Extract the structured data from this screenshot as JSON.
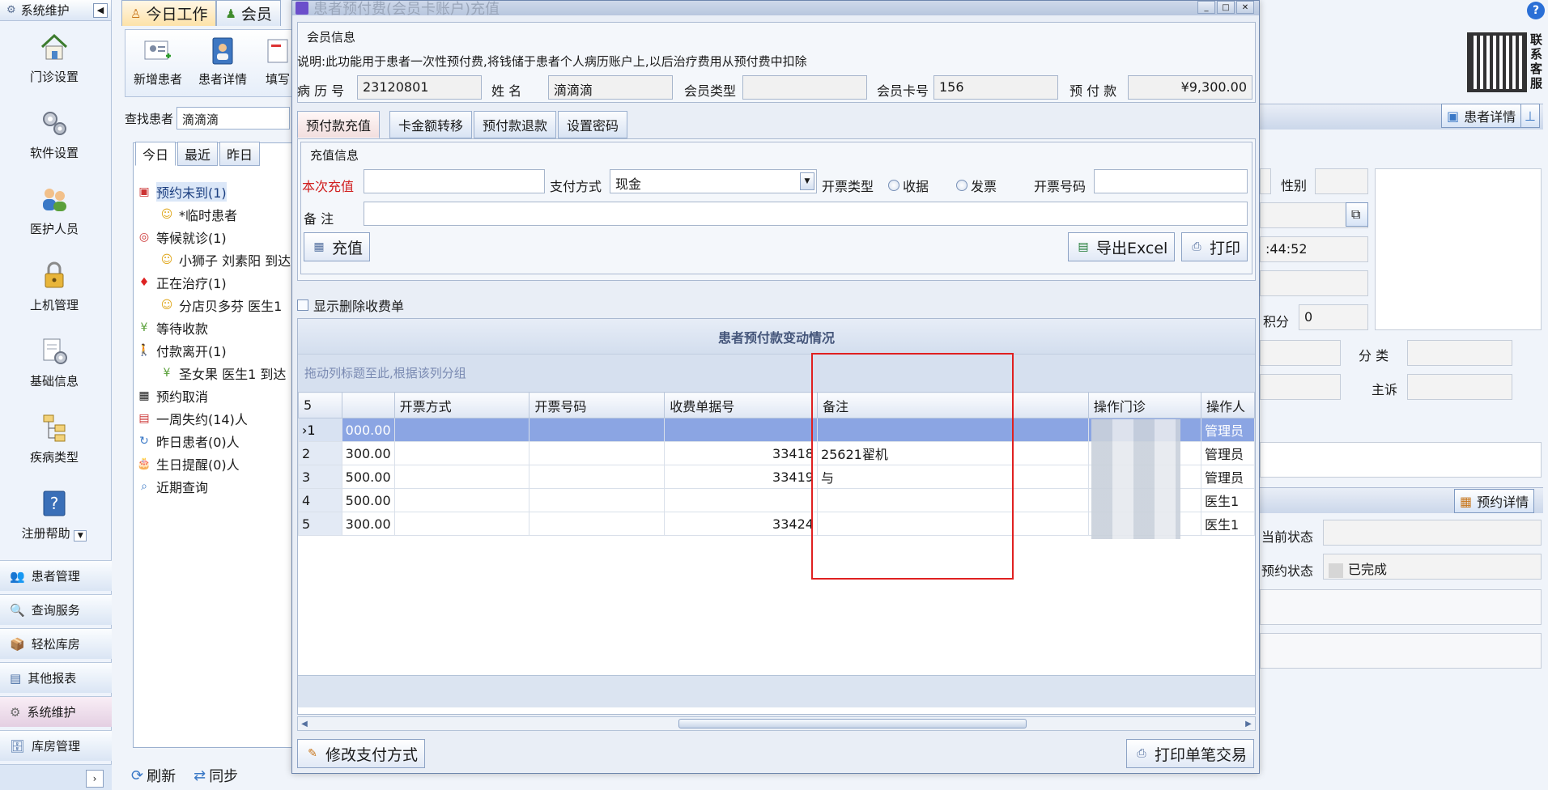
{
  "sidebar": {
    "header": "系统维护",
    "big_items": [
      {
        "label": "门诊设置",
        "icon": "home-icon"
      },
      {
        "label": "软件设置",
        "icon": "gears-icon"
      },
      {
        "label": "医护人员",
        "icon": "users-icon"
      },
      {
        "label": "上机管理",
        "icon": "lock-icon"
      },
      {
        "label": "基础信息",
        "icon": "settings-doc-icon"
      },
      {
        "label": "疾病类型",
        "icon": "tree-icon"
      },
      {
        "label": "注册帮助",
        "icon": "help-icon"
      }
    ],
    "sections": [
      {
        "label": "患者管理"
      },
      {
        "label": "查询服务"
      },
      {
        "label": "轻松库房"
      },
      {
        "label": "其他报表"
      },
      {
        "label": "系统维护"
      },
      {
        "label": "库房管理"
      }
    ]
  },
  "main": {
    "tabs": [
      {
        "label": "今日工作"
      },
      {
        "label": "会员"
      }
    ],
    "toolbar": [
      {
        "label": "新增患者"
      },
      {
        "label": "患者详情"
      },
      {
        "label": "填写"
      }
    ],
    "search_label": "查找患者",
    "search_value": "滴滴滴",
    "patient_tabs": [
      {
        "label": "今日"
      },
      {
        "label": "最近"
      },
      {
        "label": "昨日"
      }
    ],
    "tree": [
      {
        "label": "预约未到(1)",
        "child": false
      },
      {
        "label": "*临时患者",
        "child": true
      },
      {
        "label": "等候就诊(1)",
        "child": false
      },
      {
        "label": "小狮子 刘素阳 到达",
        "child": true
      },
      {
        "label": "正在治疗(1)",
        "child": false
      },
      {
        "label": "分店贝多芬 医生1",
        "child": true
      },
      {
        "label": "等待收款",
        "child": false
      },
      {
        "label": "付款离开(1)",
        "child": false
      },
      {
        "label": "圣女果 医生1 到达",
        "child": true
      },
      {
        "label": "预约取消",
        "child": false
      },
      {
        "label": "一周失约(14)人",
        "child": false
      },
      {
        "label": "昨日患者(0)人",
        "child": false
      },
      {
        "label": "生日提醒(0)人",
        "child": false
      },
      {
        "label": "近期查询",
        "child": false
      }
    ],
    "bottom": [
      {
        "label": "刷新"
      },
      {
        "label": "同步"
      }
    ]
  },
  "right": {
    "qr_label": "联系客服",
    "patient_detail_btn": "患者详情",
    "gender_label": "性别",
    "time_value": ":44:52",
    "points_label": "积分",
    "points_value": "0",
    "category_label": "分 类",
    "complaint_label": "主诉",
    "appointment_btn": "预约详情",
    "current_status_label": "当前状态",
    "appt_status_label": "预约状态",
    "appt_status_value": "已完成"
  },
  "dialog": {
    "title": "患者预付费(会员卡账户)充值",
    "member_group": "会员信息",
    "description": "说明:此功能用于患者一次性预付费,将钱储于患者个人病历账户上,以后治疗费用从预付费中扣除",
    "fields": {
      "record_label": "病 历 号",
      "record_value": "23120801",
      "name_label": "姓  名",
      "name_value": "滴滴滴",
      "member_type_label": "会员类型",
      "member_type_value": "",
      "card_label": "会员卡号",
      "card_value": "156",
      "prepay_label": "预 付 款",
      "prepay_value": "¥9,300.00"
    },
    "tabs": [
      {
        "label": "预付款充值"
      },
      {
        "label": "卡金额转移"
      },
      {
        "label": "预付款退款"
      },
      {
        "label": "设置密码"
      }
    ],
    "recharge_group": "充值信息",
    "recharge": {
      "amount_label": "本次充值",
      "amount_value": "",
      "pay_label": "支付方式",
      "pay_value": "现金",
      "invoice_type_label": "开票类型",
      "radio_receipt": "收据",
      "radio_invoice": "发票",
      "invoice_no_label": "开票号码",
      "invoice_no_value": "",
      "remark_label": "备  注",
      "remark_value": ""
    },
    "buttons": {
      "recharge": "充值",
      "export": "导出Excel",
      "print": "打印",
      "modify_pay": "修改支付方式",
      "print_single": "打印单笔交易"
    },
    "show_deleted": "显示删除收费单",
    "grid": {
      "caption": "患者预付款变动情况",
      "group_hint": "拖动列标题至此,根据该列分组",
      "count": "5",
      "columns": [
        "",
        "开票方式",
        "开票号码",
        "收费单据号",
        "备注",
        "操作门诊",
        "操作人"
      ],
      "rows": [
        {
          "n": "1",
          "amount": "000.00",
          "method": "",
          "invoice": "",
          "receipt": "",
          "remark": "",
          "clinic": "",
          "operator": "管理员"
        },
        {
          "n": "2",
          "amount": "300.00",
          "method": "",
          "invoice": "",
          "receipt": "33418",
          "remark": "25621翟机",
          "clinic": "",
          "operator": "管理员"
        },
        {
          "n": "3",
          "amount": "500.00",
          "method": "",
          "invoice": "",
          "receipt": "33419",
          "remark": "与",
          "clinic": "",
          "operator": "管理员"
        },
        {
          "n": "4",
          "amount": "500.00",
          "method": "",
          "invoice": "",
          "receipt": "",
          "remark": "",
          "clinic": "",
          "operator": "医生1"
        },
        {
          "n": "5",
          "amount": "300.00",
          "method": "",
          "invoice": "",
          "receipt": "33424",
          "remark": "",
          "clinic": "",
          "operator": "医生1"
        }
      ]
    }
  },
  "colors": {
    "accent": "#2a6fd6",
    "selected_row": "#8ba5e3",
    "required_label": "#d02020",
    "highlight_box": "#e02020"
  }
}
